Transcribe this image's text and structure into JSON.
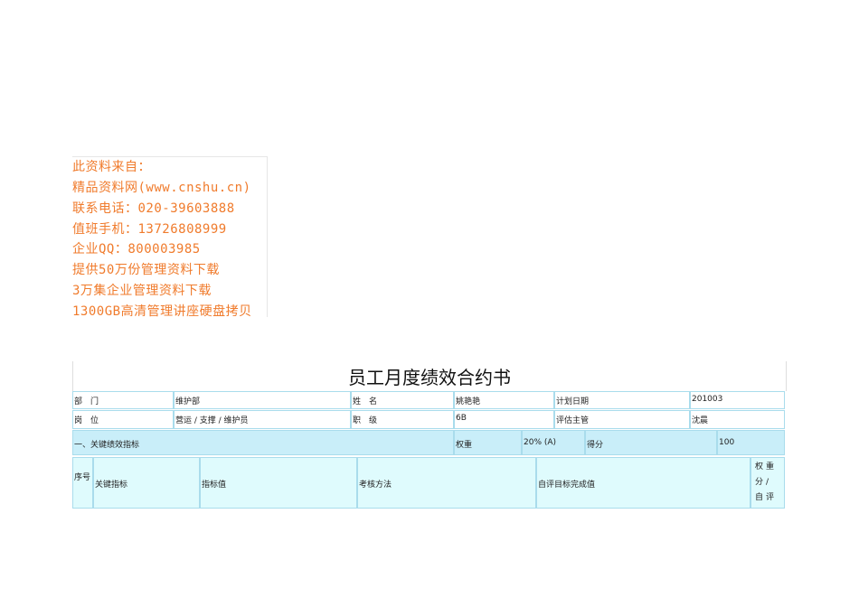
{
  "ad_lines": [
    "此资料来自：",
    "精品资料网(www.cnshu.cn)",
    "联系电话：020-39603888",
    "值班手机：13726808999",
    "企业QQ：800003985",
    "提供50万份管理资料下载",
    "3万集企业管理资料下载",
    "1300GB高清管理讲座硬盘拷贝"
  ],
  "title": "员工月度绩效合约书",
  "row1": [
    "部　门",
    "维护部",
    "姓　名",
    "姚艳艳",
    "计划日期",
    "201003"
  ],
  "row2": [
    "岗　位",
    "营运 / 支撑 / 维护员",
    "职　级",
    "6B",
    "评估主管",
    "沈晨"
  ],
  "row3": [
    "一、关键绩效指标",
    "权重",
    "20% (A)",
    "得分",
    "100"
  ],
  "row4": [
    "序号",
    "关键指标",
    "指标值",
    "考核方法",
    "自评目标完成值",
    "权重分/自评分/评"
  ],
  "colors": {
    "ad_text": "#f07b2c",
    "header_bg": "#c9eef9",
    "subheader_bg": "#dffbfd",
    "border": "#a9dcec"
  }
}
